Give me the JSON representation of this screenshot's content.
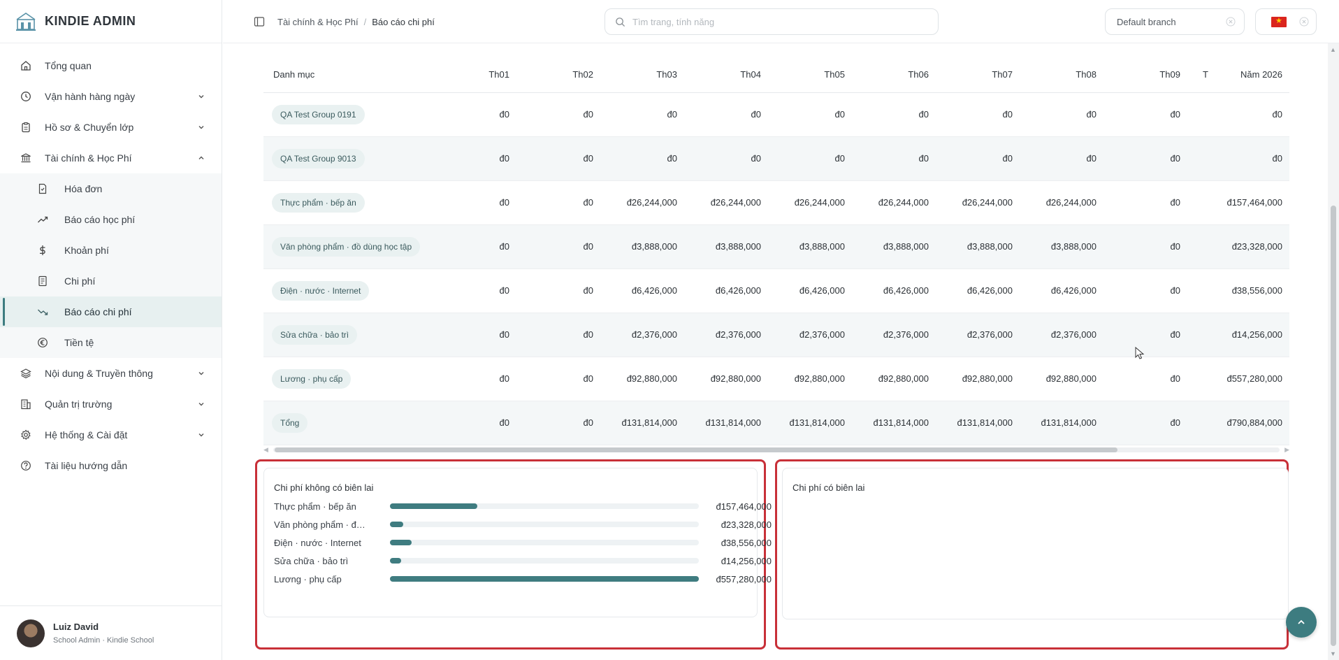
{
  "app": {
    "title": "KINDIE ADMIN"
  },
  "sidebar": {
    "items": [
      {
        "label": "Tổng quan",
        "icon": "home-icon"
      },
      {
        "label": "Vận hành hàng ngày",
        "icon": "clock-icon",
        "expandable": true
      },
      {
        "label": "Hồ sơ & Chuyển lớp",
        "icon": "clipboard-icon",
        "expandable": true
      },
      {
        "label": "Tài chính & Học Phí",
        "icon": "bank-icon",
        "expanded": true
      },
      {
        "label": "Nội dung & Truyền thông",
        "icon": "layers-icon",
        "expandable": true
      },
      {
        "label": "Quản trị trường",
        "icon": "building-icon",
        "expandable": true
      },
      {
        "label": "Hệ thống & Cài đặt",
        "icon": "gear-icon",
        "expandable": true
      },
      {
        "label": "Tài liệu hướng dẫn",
        "icon": "help-icon"
      }
    ],
    "finance_sub": [
      {
        "label": "Hóa đơn",
        "icon": "invoice-icon"
      },
      {
        "label": "Báo cáo học phí",
        "icon": "trending-up-icon"
      },
      {
        "label": "Khoản phí",
        "icon": "dollar-icon"
      },
      {
        "label": "Chi phí",
        "icon": "receipt-icon"
      },
      {
        "label": "Báo cáo chi phí",
        "icon": "trending-down-icon",
        "active": true
      },
      {
        "label": "Tiền tệ",
        "icon": "euro-icon"
      }
    ]
  },
  "user": {
    "name": "Luiz David",
    "role": "School Admin · Kindie School"
  },
  "header": {
    "breadcrumb": [
      "Tài chính & Học Phí",
      "Báo cáo chi phí"
    ],
    "search_placeholder": "Tìm trang, tính năng",
    "branch": "Default branch"
  },
  "table": {
    "columns": [
      "Danh mục",
      "Th01",
      "Th02",
      "Th03",
      "Th04",
      "Th05",
      "Th06",
      "Th07",
      "Th08",
      "Th09",
      "T",
      "Năm 2026"
    ],
    "rows": [
      {
        "category": "QA Test Group 0191",
        "cells": [
          "đ0",
          "đ0",
          "đ0",
          "đ0",
          "đ0",
          "đ0",
          "đ0",
          "đ0",
          "đ0",
          "",
          "đ0"
        ]
      },
      {
        "category": "QA Test Group 9013",
        "cells": [
          "đ0",
          "đ0",
          "đ0",
          "đ0",
          "đ0",
          "đ0",
          "đ0",
          "đ0",
          "đ0",
          "",
          "đ0"
        ]
      },
      {
        "category": "Thực phẩm · bếp ăn",
        "cells": [
          "đ0",
          "đ0",
          "đ26,244,000",
          "đ26,244,000",
          "đ26,244,000",
          "đ26,244,000",
          "đ26,244,000",
          "đ26,244,000",
          "đ0",
          "",
          "đ157,464,000"
        ]
      },
      {
        "category": "Văn phòng phẩm · đồ dùng học tập",
        "cells": [
          "đ0",
          "đ0",
          "đ3,888,000",
          "đ3,888,000",
          "đ3,888,000",
          "đ3,888,000",
          "đ3,888,000",
          "đ3,888,000",
          "đ0",
          "",
          "đ23,328,000"
        ]
      },
      {
        "category": "Điện · nước · Internet",
        "cells": [
          "đ0",
          "đ0",
          "đ6,426,000",
          "đ6,426,000",
          "đ6,426,000",
          "đ6,426,000",
          "đ6,426,000",
          "đ6,426,000",
          "đ0",
          "",
          "đ38,556,000"
        ]
      },
      {
        "category": "Sửa chữa · bảo trì",
        "cells": [
          "đ0",
          "đ0",
          "đ2,376,000",
          "đ2,376,000",
          "đ2,376,000",
          "đ2,376,000",
          "đ2,376,000",
          "đ2,376,000",
          "đ0",
          "",
          "đ14,256,000"
        ]
      },
      {
        "category": "Lương · phụ cấp",
        "cells": [
          "đ0",
          "đ0",
          "đ92,880,000",
          "đ92,880,000",
          "đ92,880,000",
          "đ92,880,000",
          "đ92,880,000",
          "đ92,880,000",
          "đ0",
          "",
          "đ557,280,000"
        ]
      },
      {
        "category": "Tổng",
        "cells": [
          "đ0",
          "đ0",
          "đ131,814,000",
          "đ131,814,000",
          "đ131,814,000",
          "đ131,814,000",
          "đ131,814,000",
          "đ131,814,000",
          "đ0",
          "",
          "đ790,884,000"
        ]
      }
    ]
  },
  "panels": {
    "no_receipt": {
      "title": "Chi phí không có biên lai",
      "items": [
        {
          "label": "Thực phẩm · bếp ăn",
          "value": "đ157,464,000",
          "fraction": 0.2826
        },
        {
          "label": "Văn phòng phẩm · đ…",
          "value": "đ23,328,000",
          "fraction": 0.0419
        },
        {
          "label": "Điện · nước · Internet",
          "value": "đ38,556,000",
          "fraction": 0.0692
        },
        {
          "label": "Sửa chữa · bảo trì",
          "value": "đ14,256,000",
          "fraction": 0.0256
        },
        {
          "label": "Lương · phụ cấp",
          "value": "đ557,280,000",
          "fraction": 1.0
        }
      ]
    },
    "with_receipt": {
      "title": "Chi phí có biên lai"
    }
  },
  "colors": {
    "accent": "#3d7c80",
    "highlight_outline": "#c83038"
  }
}
